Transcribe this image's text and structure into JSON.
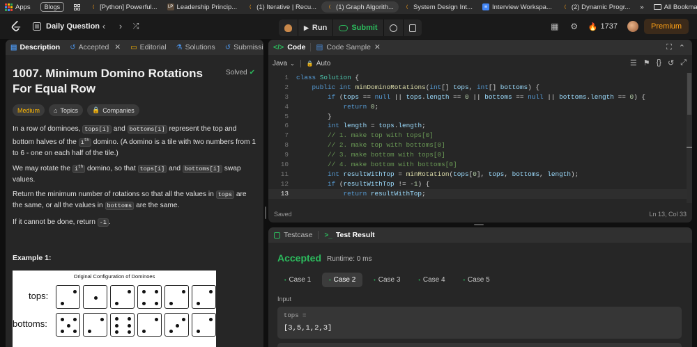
{
  "bookmarks": {
    "items": [
      {
        "label": "Apps",
        "icon": "apps-grid-icon"
      },
      {
        "label": "Blogs",
        "icon": ""
      },
      {
        "label": "",
        "icon": "grid-icon"
      },
      {
        "label": "[Python] Powerful...",
        "icon": "leetcode-icon"
      },
      {
        "label": "Leadership Princip...",
        "icon": "lp-icon"
      },
      {
        "label": "(1) Iterative | Recu...",
        "icon": "leetcode-icon"
      },
      {
        "label": "(1) Graph Algorith...",
        "icon": "leetcode-icon"
      },
      {
        "label": "System Design Int...",
        "icon": "leetcode-icon"
      },
      {
        "label": "Interview Workspa...",
        "icon": "doc-icon"
      },
      {
        "label": "(2) Dynamic Progr...",
        "icon": "leetcode-icon"
      }
    ],
    "more": "»",
    "all_bookmarks": "All Bookmarks"
  },
  "topnav": {
    "daily_question": "Daily Question",
    "run": "Run",
    "submit": "Submit",
    "streak": "1737",
    "premium": "Premium"
  },
  "left": {
    "tabs": {
      "description": "Description",
      "accepted": "Accepted",
      "editorial": "Editorial",
      "solutions": "Solutions",
      "submissions": "Submissions"
    },
    "title": "1007. Minimum Domino Rotations For Equal Row",
    "solved": "Solved",
    "chips": {
      "difficulty": "Medium",
      "topics": "Topics",
      "companies": "Companies"
    },
    "p1": {
      "a": "In a row of dominoes, ",
      "c1": "tops[i]",
      "b": " and ",
      "c2": "bottoms[i]",
      "c": " represent the top and bottom halves of the ",
      "c3": "i",
      "sup": "th",
      "d": " domino. (A domino is a tile with two numbers from 1 to 6 - one on each half of the tile.)"
    },
    "p2": {
      "a": "We may rotate the ",
      "c1": "i",
      "sup": "th",
      "b": " domino, so that ",
      "c2": "tops[i]",
      "c": " and ",
      "c3": "bottoms[i]",
      "d": " swap values."
    },
    "p3": {
      "a": "Return the minimum number of rotations so that all the values in ",
      "c1": "tops",
      "b": " are the same, or all the values in ",
      "c2": "bottoms",
      "c": " are the same."
    },
    "p4": {
      "a": "If it cannot be done, return ",
      "c1": "-1",
      "b": "."
    },
    "example_title": "Example 1:",
    "figure": {
      "title": "Original Configuration of Dominoes",
      "tops_label": "tops:",
      "bottoms_label": "bottoms:"
    }
  },
  "code": {
    "tabs": {
      "code": "Code",
      "sample": "Code Sample"
    },
    "language": "Java",
    "auto": "Auto",
    "saved": "Saved",
    "cursor": "Ln 13, Col 33",
    "lines": [
      {
        "n": "1",
        "html": "<span class='kw'>class</span> <span class='ty'>Solution</span> {"
      },
      {
        "n": "2",
        "html": "    <span class='kw'>public</span> <span class='kw'>int</span> <span class='fn'>minDominoRotations</span>(<span class='kw'>int</span>[] <span class='vr'>tops</span>, <span class='kw'>int</span>[] <span class='vr'>bottoms</span>) {"
      },
      {
        "n": "3",
        "html": "        <span class='kw'>if</span> (<span class='vr'>tops</span> == <span class='kw'>null</span> || <span class='vr'>tops</span>.<span class='vr'>length</span> == <span class='num'>0</span> || <span class='vr'>bottoms</span> == <span class='kw'>null</span> || <span class='vr'>bottoms</span>.<span class='vr'>length</span> == <span class='num'>0</span>) {"
      },
      {
        "n": "4",
        "html": "            <span class='kw'>return</span> <span class='num'>0</span>;"
      },
      {
        "n": "5",
        "html": "        }"
      },
      {
        "n": "6",
        "html": "        <span class='kw'>int</span> <span class='vr'>length</span> = <span class='vr'>tops</span>.<span class='vr'>length</span>;"
      },
      {
        "n": "7",
        "html": "        <span class='cm'>// 1. make top with tops[0]</span>"
      },
      {
        "n": "8",
        "html": "        <span class='cm'>// 2. make top with bottoms[0]</span>"
      },
      {
        "n": "9",
        "html": "        <span class='cm'>// 3. make bottom with tops[0]</span>"
      },
      {
        "n": "10",
        "html": "        <span class='cm'>// 4. make bottom with bottoms[0]</span>"
      },
      {
        "n": "11",
        "html": "        <span class='kw'>int</span> <span class='vr'>resultWithTop</span> = <span class='fn'>minRotation</span>(<span class='vr'>tops</span>[<span class='num'>0</span>], <span class='vr'>tops</span>, <span class='vr'>bottoms</span>, <span class='vr'>length</span>);"
      },
      {
        "n": "12",
        "html": "        <span class='kw'>if</span> (<span class='vr'>resultWithTop</span> != -<span class='num'>1</span>) {"
      },
      {
        "n": "13",
        "html": "            <span class='kw'>return</span> <span class='vr'>resultWithTop</span>;"
      }
    ],
    "current_line": "13"
  },
  "result": {
    "tabs": {
      "testcase": "Testcase",
      "test_result": "Test Result"
    },
    "status": "Accepted",
    "runtime": "Runtime: 0 ms",
    "cases": [
      "Case 1",
      "Case 2",
      "Case 3",
      "Case 4",
      "Case 5"
    ],
    "active_case": 1,
    "input_label": "Input",
    "var_name": "tops =",
    "var_value": "[3,5,1,2,3]"
  },
  "colors": {
    "accent": "#ffa116",
    "success": "#2cbb5d",
    "medium": "#ffb800"
  }
}
